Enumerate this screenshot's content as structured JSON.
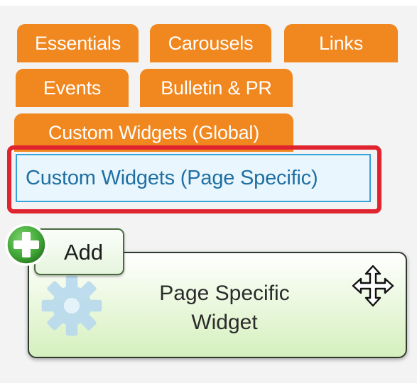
{
  "tabs": [
    {
      "label": "Essentials"
    },
    {
      "label": "Carousels"
    },
    {
      "label": "Links"
    },
    {
      "label": "Events"
    },
    {
      "label": "Bulletin & PR"
    },
    {
      "label": "Custom Widgets (Global)"
    }
  ],
  "active_tab": {
    "label": "Custom Widgets (Page Specific)"
  },
  "add_button": {
    "label": "Add"
  },
  "widget": {
    "title_line1": "Page Specific",
    "title_line2": "Widget"
  },
  "icons": {
    "add": "plus-circle-icon",
    "widget": "gear-icon",
    "move": "move-arrows-icon"
  },
  "colors": {
    "tab": "#f0871f",
    "active_tab_bg": "#e9f6fd",
    "active_tab_border": "#38a3d8",
    "highlight": "#e0242f",
    "add_green": "#3fa535"
  }
}
